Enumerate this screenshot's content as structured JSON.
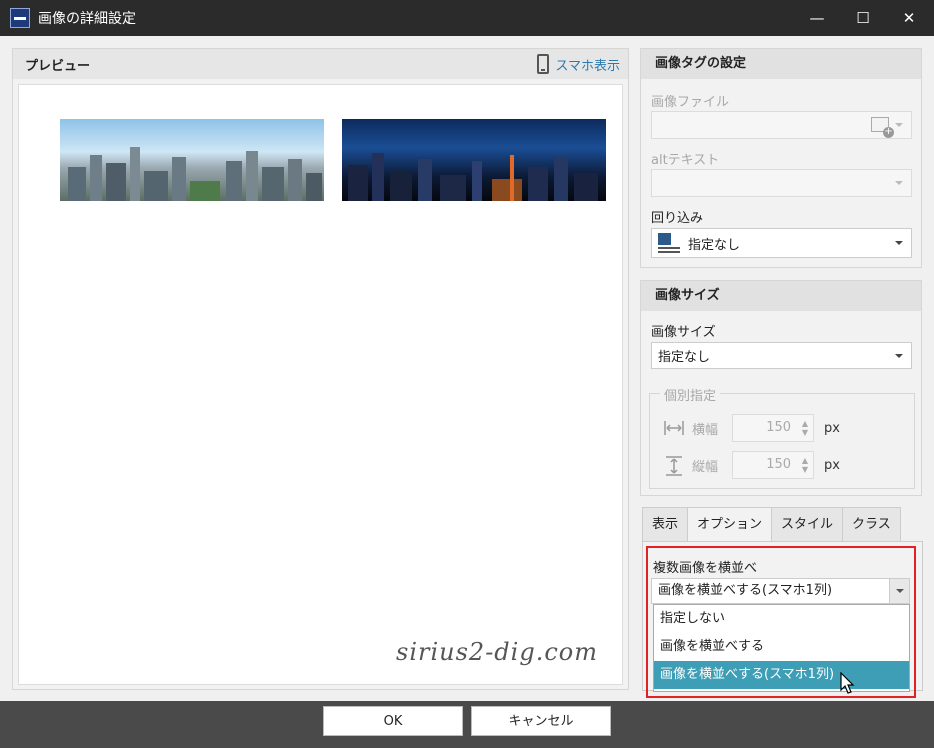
{
  "window": {
    "title": "画像の詳細設定",
    "minimize_glyph": "—",
    "maximize_glyph": "☐",
    "close_glyph": "✕"
  },
  "preview": {
    "title": "プレビュー",
    "smartphone_label": "スマホ表示",
    "watermark": "sirius2-dig.com"
  },
  "image_tag": {
    "header": "画像タグの設定",
    "image_file_label": "画像ファイル",
    "image_file_value": "",
    "alt_label": "altテキスト",
    "alt_value": "",
    "wrap_label": "回り込み",
    "wrap_value": "指定なし"
  },
  "image_size": {
    "header": "画像サイズ",
    "size_label": "画像サイズ",
    "size_value": "指定なし",
    "individual_legend": "個別指定",
    "width_label": "横幅",
    "width_value": "150",
    "height_label": "縦幅",
    "height_value": "150",
    "unit": "px"
  },
  "tabs": [
    {
      "label": "表示"
    },
    {
      "label": "オプション"
    },
    {
      "label": "スタイル"
    },
    {
      "label": "クラス"
    }
  ],
  "options": {
    "multi_image_label": "複数画像を横並べ",
    "selected_value": "画像を横並べする(スマホ1列)",
    "dropdown_items": [
      "指定しない",
      "画像を横並べする",
      "画像を横並べする(スマホ1列)"
    ]
  },
  "footer": {
    "ok_label": "OK",
    "cancel_label": "キャンセル"
  },
  "colors": {
    "highlight_border": "#e12222",
    "selected_item": "#3d9eb5",
    "link": "#2a7ab0"
  }
}
